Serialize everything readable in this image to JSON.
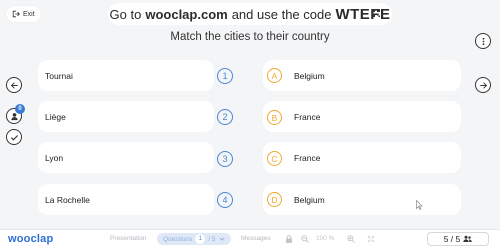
{
  "header": {
    "exit_label": "Exit",
    "join_prefix": "Go to",
    "join_site": "wooclap.com",
    "join_middle": "and use the code",
    "join_code": "WTEFE"
  },
  "question": "Match the cities to their country",
  "participants_badge": "0",
  "left_items": [
    {
      "number": "1",
      "label": "Tournai"
    },
    {
      "number": "2",
      "label": "Liège"
    },
    {
      "number": "3",
      "label": "Lyon"
    },
    {
      "number": "4",
      "label": "La Rochelle"
    }
  ],
  "right_items": [
    {
      "letter": "A",
      "label": "Belgium"
    },
    {
      "letter": "B",
      "label": "France"
    },
    {
      "letter": "C",
      "label": "France"
    },
    {
      "letter": "D",
      "label": "Belgium"
    }
  ],
  "bottom_bar": {
    "logo": "wooclap",
    "presentation": "Presentation",
    "questions": "Questions",
    "question_index": "1",
    "question_total": "/ 5",
    "messages": "Messages",
    "zoom": "100 %",
    "count": "5 / 5"
  },
  "colors": {
    "accent_blue": "#4a86d8",
    "accent_orange": "#f0a830",
    "brand": "#2d6fd2"
  }
}
